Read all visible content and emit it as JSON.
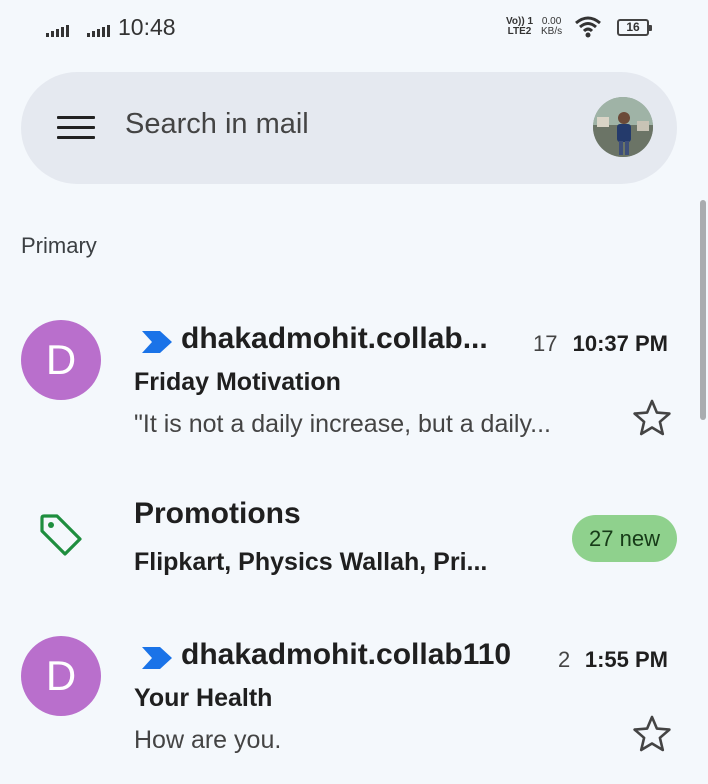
{
  "status_bar": {
    "time": "10:48",
    "volte_line1": "Vo)) 1",
    "volte_line2": "LTE2",
    "speed_value": "0.00",
    "speed_unit": "KB/s",
    "battery": "16"
  },
  "search": {
    "placeholder": "Search in mail",
    "menu_icon": "hamburger-menu-icon",
    "avatar_icon": "profile-avatar"
  },
  "section_label": "Primary",
  "emails": [
    {
      "avatar_letter": "D",
      "sender": "dhakadmohit.collab...",
      "count": "17",
      "time": "10:37 PM",
      "subject": "Friday Motivation",
      "snippet": "\"It is not a daily increase, but a daily...",
      "important_icon": "importance-marker-icon",
      "star_icon": "star-outline-icon"
    },
    {
      "avatar_letter": "D",
      "sender": "dhakadmohit.collab110",
      "count": "2",
      "time": "1:55 PM",
      "subject": "Your Health",
      "snippet": "How are you.",
      "important_icon": "importance-marker-icon",
      "star_icon": "star-outline-icon"
    }
  ],
  "promotions": {
    "title": "Promotions",
    "senders": "Flipkart, Physics Wallah, Pri...",
    "badge": "27 new",
    "icon": "tag-icon"
  },
  "colors": {
    "background": "#f4f8fc",
    "avatar_purple": "#b96fcc",
    "badge_green": "#8fd18d",
    "promo_icon_green": "#1e8e3e",
    "important_blue": "#1a73e8"
  }
}
